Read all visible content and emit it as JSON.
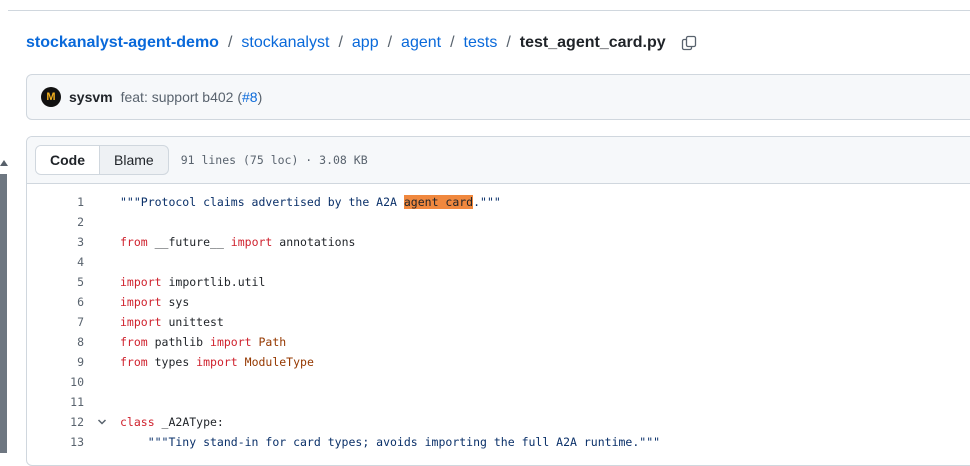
{
  "breadcrumb": {
    "repo": "stockanalyst-agent-demo",
    "segments": [
      "stockanalyst",
      "app",
      "agent",
      "tests"
    ],
    "separator": "/",
    "file": "test_agent_card.py"
  },
  "commit": {
    "avatar_letter": "M",
    "author": "sysvm",
    "message": "feat: support b402 (",
    "pr": "#8",
    "message_end": ")"
  },
  "file_header": {
    "tab_code": "Code",
    "tab_blame": "Blame",
    "meta": "91 lines (75 loc) · 3.08 KB"
  },
  "code_lines": [
    {
      "n": "1",
      "parts": [
        {
          "t": "\"\"\"Protocol claims advertised by the A2A ",
          "c": "st"
        },
        {
          "t": "agent card",
          "c": "hl"
        },
        {
          "t": ".\"\"\"",
          "c": "st"
        }
      ]
    },
    {
      "n": "2",
      "parts": []
    },
    {
      "n": "3",
      "parts": [
        {
          "t": "from",
          "c": "kw"
        },
        {
          "t": " __future__ ",
          "c": ""
        },
        {
          "t": "import",
          "c": "kw"
        },
        {
          "t": " annotations",
          "c": ""
        }
      ]
    },
    {
      "n": "4",
      "parts": []
    },
    {
      "n": "5",
      "parts": [
        {
          "t": "import",
          "c": "kw"
        },
        {
          "t": " importlib.util",
          "c": ""
        }
      ]
    },
    {
      "n": "6",
      "parts": [
        {
          "t": "import",
          "c": "kw"
        },
        {
          "t": " sys",
          "c": ""
        }
      ]
    },
    {
      "n": "7",
      "parts": [
        {
          "t": "import",
          "c": "kw"
        },
        {
          "t": " unittest",
          "c": ""
        }
      ]
    },
    {
      "n": "8",
      "parts": [
        {
          "t": "from",
          "c": "kw"
        },
        {
          "t": " pathlib ",
          "c": ""
        },
        {
          "t": "import",
          "c": "kw"
        },
        {
          "t": " Path",
          "c": "cls"
        }
      ]
    },
    {
      "n": "9",
      "parts": [
        {
          "t": "from",
          "c": "kw"
        },
        {
          "t": " types ",
          "c": ""
        },
        {
          "t": "import",
          "c": "kw"
        },
        {
          "t": " ModuleType",
          "c": "cls"
        }
      ]
    },
    {
      "n": "10",
      "parts": []
    },
    {
      "n": "11",
      "parts": []
    },
    {
      "n": "12",
      "fold": true,
      "parts": [
        {
          "t": "class",
          "c": "kw"
        },
        {
          "t": " _A2AType:",
          "c": ""
        }
      ]
    },
    {
      "n": "13",
      "parts": [
        {
          "t": "    \"\"\"Tiny stand-in for card types; avoids importing the full A2A runtime.\"\"\"",
          "c": "st"
        }
      ]
    }
  ],
  "icons": {
    "copy": "copy-icon",
    "fold": "chevron-down-icon"
  }
}
